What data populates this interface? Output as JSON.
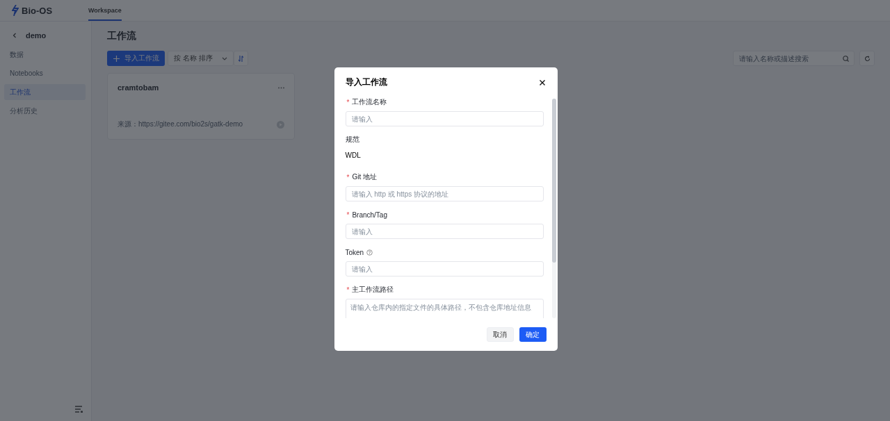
{
  "header": {
    "logo": "Bio-OS",
    "tabs": [
      {
        "label": "Workspace",
        "selected": true
      }
    ]
  },
  "sidebar": {
    "back_title": "demo",
    "items": [
      {
        "label": "数据",
        "selected": false
      },
      {
        "label": "Notebooks",
        "selected": false
      },
      {
        "label": "工作流",
        "selected": true
      },
      {
        "label": "分析历史",
        "selected": false
      }
    ]
  },
  "main": {
    "title": "工作流",
    "import_button": "导入工作流",
    "sort": "按 名称 排序",
    "search": {
      "placeholder": "请输入名称或描述搜索"
    },
    "cards": [
      {
        "name": "cramtobam",
        "source": "来源：https://gitee.com/bio2s/gatk-demo"
      }
    ]
  },
  "dialog": {
    "title": "导入工作流",
    "fields": [
      {
        "kind": "input",
        "required_mark": "*",
        "label": "工作流名称",
        "help": false,
        "placeholder": "请输入"
      },
      {
        "kind": "static",
        "label": "规范",
        "help": false,
        "value": "WDL"
      },
      {
        "kind": "input",
        "required_mark": "*",
        "label": "Git 地址",
        "help": false,
        "placeholder": "请输入 http 或 https 协议的地址"
      },
      {
        "kind": "input",
        "required_mark": "*",
        "label": "Branch/Tag",
        "help": false,
        "placeholder": "请输入"
      },
      {
        "kind": "input",
        "label": "Token",
        "help": true,
        "placeholder": "请输入"
      },
      {
        "kind": "textarea",
        "required_mark": "*",
        "label": "主工作流路径",
        "help": false,
        "placeholder": "请输入仓库内的指定文件的具体路径，不包含仓库地址信息"
      }
    ],
    "buttons": {
      "cancel": "取消",
      "ok": "确定"
    }
  }
}
